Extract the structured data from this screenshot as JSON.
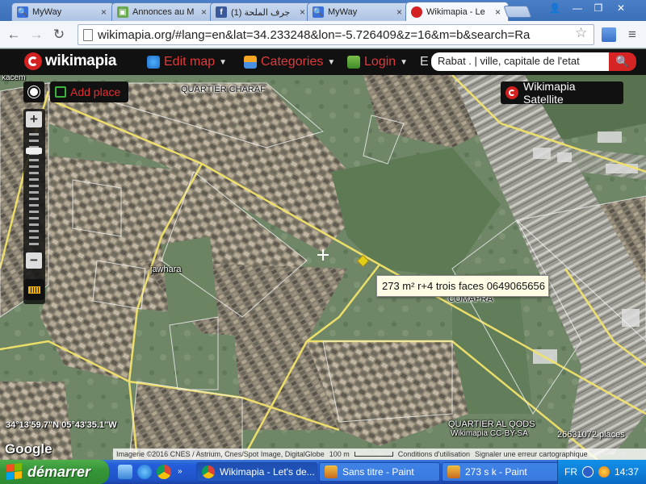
{
  "browser": {
    "tabs": [
      {
        "label": "MyWay",
        "icon": "search-icon",
        "active": false
      },
      {
        "label": "Annonces au M",
        "icon": "box-icon",
        "active": false
      },
      {
        "label": "(1) جرف الملحة",
        "icon": "facebook-icon",
        "active": false
      },
      {
        "label": "MyWay",
        "icon": "search-icon",
        "active": false
      },
      {
        "label": "Wikimapia - Le",
        "icon": "wikimapia-icon",
        "active": true
      }
    ],
    "url": "wikimapia.org/#lang=en&lat=34.233248&lon=-5.726409&z=16&m=b&search=Ra"
  },
  "wikimapia": {
    "logo": "wikimapia",
    "menu": {
      "edit_map": "Edit map",
      "categories": "Categories",
      "login": "Login",
      "extra": "E"
    },
    "search_value": "Rabat . | ville, capitale de l'etat",
    "add_place": "Add place",
    "layer": "Wikimapia Satellite"
  },
  "map": {
    "labels": {
      "kacem": "kacem",
      "charaf": "QUARTIER CHARAF",
      "jawhara": "jawhara",
      "comapra": "COMAPRA",
      "qods": "QUARTIER AL QODS",
      "license": "Wikimapia CC-BY-SA"
    },
    "tooltip": "273 m² r+4 trois faces 0649065656",
    "coords": "34°13'59.7\"N 05°43'35.1\"W",
    "google": "Google",
    "places": "26631072 places",
    "attribution": {
      "imagery": "Imagerie ©2016 CNES / Astrium, Cnes/Spot Image, DigitalGlobe",
      "scale": "100 m",
      "terms": "Conditions d'utilisation",
      "report": "Signaler une erreur cartographique"
    }
  },
  "taskbar": {
    "start": "démarrer",
    "tasks": [
      {
        "label": "Wikimapia - Let's de...",
        "icon": "chrome-icon",
        "active": true
      },
      {
        "label": "Sans titre - Paint",
        "icon": "paint-icon",
        "active": false
      },
      {
        "label": "273 s k - Paint",
        "icon": "paint-icon",
        "active": false
      }
    ],
    "lang": "FR",
    "time": "14:37"
  }
}
